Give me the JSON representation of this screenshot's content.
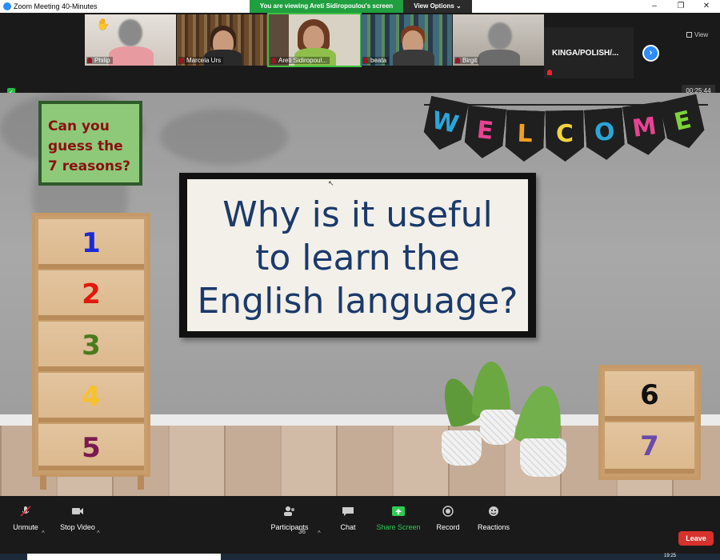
{
  "window": {
    "title": "Zoom Meeting 40-Minutes",
    "controls": [
      "–",
      "❐",
      "✕"
    ]
  },
  "share_banner": {
    "text": "You are viewing Areti Sidiropoulou's screen",
    "view_options": "View Options ⌄"
  },
  "participants": [
    {
      "name": "Philip",
      "muted": true,
      "hand_raised": true,
      "video_blurred": true
    },
    {
      "name": "Marcela Urs",
      "muted": true
    },
    {
      "name": "Areti Sidiropoul...",
      "muted": true,
      "active_speaker": true
    },
    {
      "name": "beata",
      "muted": true
    },
    {
      "name": "Birgit",
      "muted": true,
      "video_blurred": true
    },
    {
      "name": "KINGA/POLISH/...",
      "muted": true,
      "video_off": true
    }
  ],
  "strip_nav": {
    "next_icon": "chevron-right-icon"
  },
  "view_button": "View",
  "timer": "00:25:44",
  "slide": {
    "sign_lines": [
      "Can you",
      "guess the",
      "7 reasons?"
    ],
    "banner_letters": [
      "W",
      "E",
      "L",
      "C",
      "O",
      "M",
      "E"
    ],
    "banner_colors": [
      "#2aa6d8",
      "#e84393",
      "#f0a020",
      "#f2d43a",
      "#2aa6d8",
      "#e84393",
      "#7ed23a"
    ],
    "board_lines": [
      "Why is it useful",
      "to learn the",
      "English language?"
    ],
    "left_numbers": [
      "1",
      "2",
      "3",
      "4",
      "5"
    ],
    "left_colors": [
      "#1a2bd6",
      "#e0180f",
      "#4a7a1e",
      "#f6c22a",
      "#7a1a4f"
    ],
    "right_numbers": [
      "6",
      "7"
    ],
    "right_colors": [
      "#111111",
      "#6a4aaa"
    ]
  },
  "toolbar": {
    "unmute": "Unmute",
    "stop_video": "Stop Video",
    "participants": "Participants",
    "participant_count": "36",
    "chat": "Chat",
    "share_screen": "Share Screen",
    "record": "Record",
    "reactions": "Reactions",
    "leave": "Leave"
  },
  "taskbar": {
    "clock": "19:25"
  },
  "colors": {
    "accent": "#2d8cff",
    "share_green": "#1f9f3f",
    "leave_red": "#d6312b"
  }
}
